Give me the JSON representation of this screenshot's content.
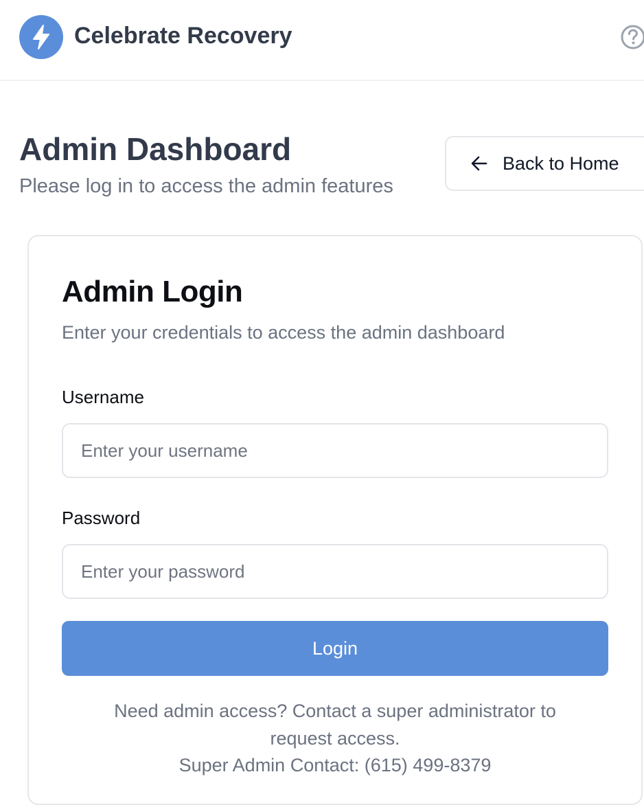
{
  "header": {
    "app_title": "Celebrate Recovery",
    "logo_icon": "lightning-bolt-icon",
    "help_icon": "help-circle-icon",
    "brand_color": "#5a8edb"
  },
  "page": {
    "title": "Admin Dashboard",
    "subtitle": "Please log in to access the admin features",
    "back_button_label": "Back to Home",
    "back_icon": "arrow-left-icon"
  },
  "login_card": {
    "title": "Admin Login",
    "description": "Enter your credentials to access the admin dashboard",
    "username_label": "Username",
    "username_placeholder": "Enter your username",
    "username_value": "",
    "password_label": "Password",
    "password_placeholder": "Enter your password",
    "password_value": "",
    "login_button_label": "Login",
    "button_color": "#5b8ed9",
    "info_line_1": "Need admin access? Contact a super administrator to",
    "info_line_2": "request access.",
    "info_line_3": "Super Admin Contact: (615) 499-8379"
  }
}
